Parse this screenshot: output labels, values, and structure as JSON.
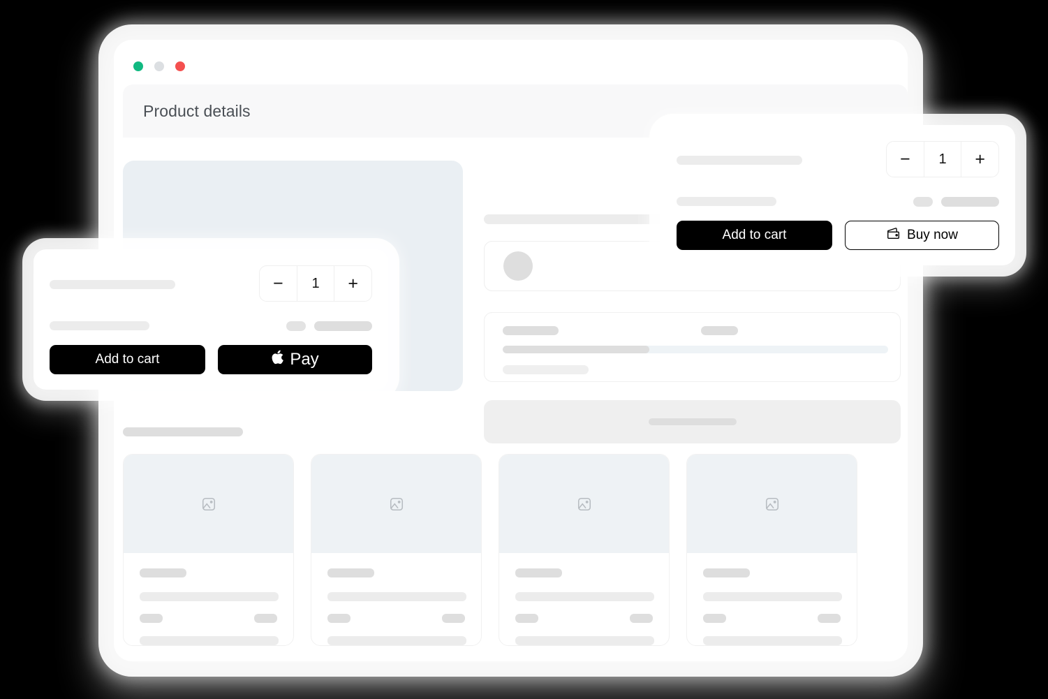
{
  "window": {
    "traffic_lights": [
      {
        "name": "minimize",
        "color": "#11b981"
      },
      {
        "name": "maximize",
        "color": "#dcdfe2"
      },
      {
        "name": "close",
        "color": "#f4504f"
      }
    ],
    "appbar_title": "Product details"
  },
  "product": {
    "gallery_placeholder": "product-image-placeholder",
    "option_swatch": "color-swatch",
    "progress_percent": 38
  },
  "recommendations": {
    "section_title_placeholder": "",
    "cards": [
      {
        "image_icon": "image-placeholder-icon"
      },
      {
        "image_icon": "image-placeholder-icon"
      },
      {
        "image_icon": "image-placeholder-icon"
      },
      {
        "image_icon": "image-placeholder-icon"
      }
    ]
  },
  "widget_left": {
    "quantity": {
      "decrement_label": "−",
      "value": "1",
      "increment_label": "+"
    },
    "add_to_cart_label": "Add to cart",
    "apple_pay_label": "Pay",
    "apple_glyph": ""
  },
  "widget_right": {
    "quantity": {
      "decrement_label": "−",
      "value": "1",
      "increment_label": "+"
    },
    "add_to_cart_label": "Add to cart",
    "buy_now_label": "Buy now",
    "buy_now_icon": "wallet-icon"
  },
  "colors": {
    "accent_dark": "#000000",
    "surface": "#ffffff",
    "skeleton": "#ececec",
    "skeleton_dark": "#dedede",
    "image_placeholder": "#eef2f5",
    "appbar": "#f8f8f9",
    "canvas": "#000000"
  }
}
